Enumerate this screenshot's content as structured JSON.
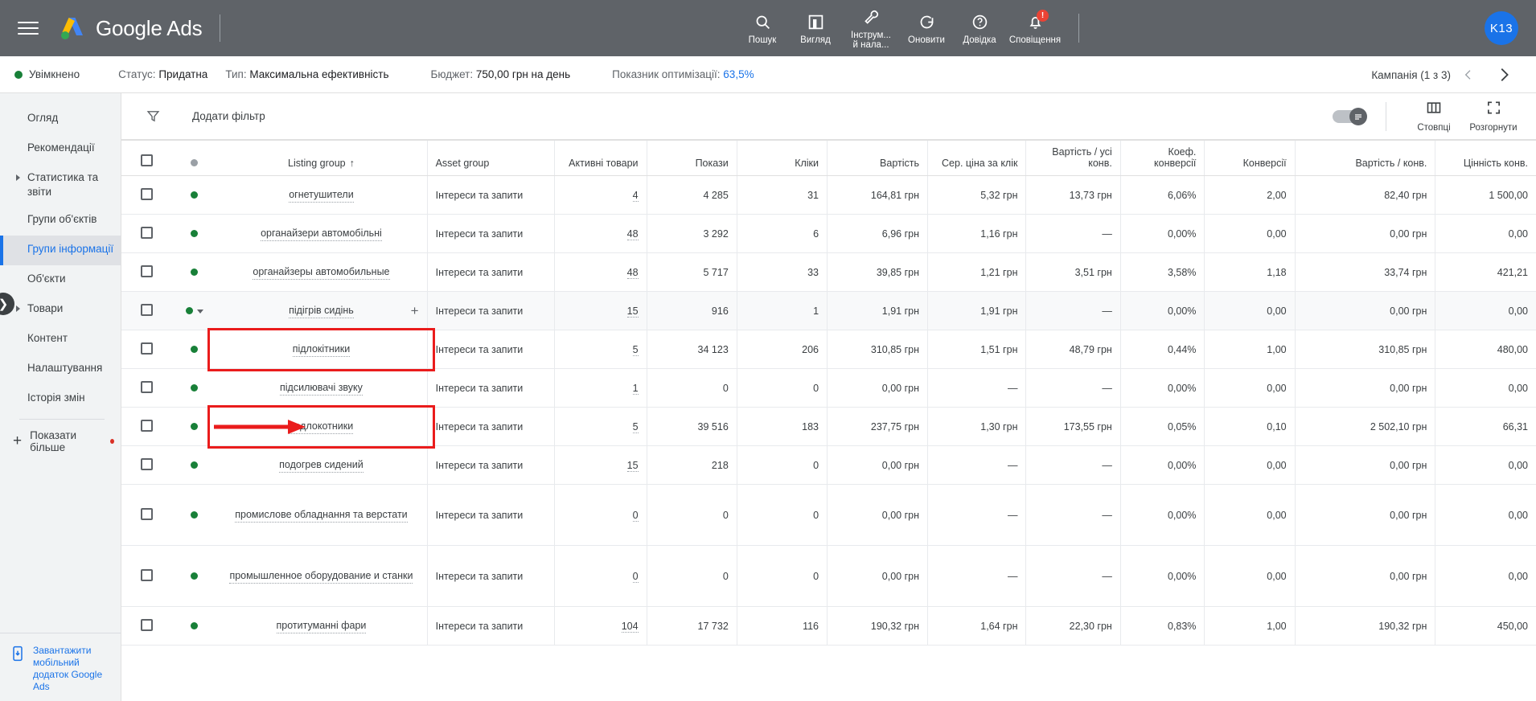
{
  "topbar": {
    "product_name": "Google Ads",
    "menu_icon": "hamburger-icon",
    "actions": [
      {
        "label": "Пошук",
        "icon": "search-icon"
      },
      {
        "label": "Вигляд",
        "icon": "view-bar-chart-icon"
      },
      {
        "label": "Інструм...",
        "label2": "й нала...",
        "icon": "wrench-tools-icon"
      },
      {
        "label": "Оновити",
        "icon": "refresh-icon"
      },
      {
        "label": "Довідка",
        "icon": "help-question-icon"
      },
      {
        "label": "Сповіщення",
        "icon": "bell-notifications-icon",
        "badge": "!"
      }
    ],
    "avatar": "K13",
    "accent_blue": "#1a73e8",
    "bar_bg": "#5f6368"
  },
  "statusbar": {
    "enabled_label": "Увімкнено",
    "status_prefix": "Статус:",
    "status_value": "Придатна",
    "type_prefix": "Тип:",
    "type_value": "Максимальна ефективність",
    "budget_prefix": "Бюджет:",
    "budget_value": "750,00 грн на день",
    "optscore_prefix": "Показник оптимізації:",
    "optscore_value": "63,5%",
    "campaign_nav": "Кампанія (1 з 3)",
    "green": "#188038"
  },
  "sidebar": {
    "items": [
      {
        "label": "Огляд",
        "expandable": false,
        "active": false
      },
      {
        "label": "Рекомендації",
        "expandable": false,
        "active": false
      },
      {
        "label": "Статистика та звіти",
        "expandable": true,
        "active": false
      },
      {
        "label": "Групи об'єктів",
        "expandable": false,
        "active": false
      },
      {
        "label": "Групи інформації",
        "expandable": false,
        "active": true
      },
      {
        "label": "Об'єкти",
        "expandable": false,
        "active": false
      },
      {
        "label": "Товари",
        "expandable": true,
        "active": false
      },
      {
        "label": "Контент",
        "expandable": false,
        "active": false
      },
      {
        "label": "Налаштування",
        "expandable": false,
        "active": false
      },
      {
        "label": "Історія змін",
        "expandable": false,
        "active": false
      }
    ],
    "show_more": "Показати більше",
    "footer_link": "Завантажити мобільний додаток Google Ads",
    "footer_icon": "mobile-download-icon"
  },
  "toolbar": {
    "filter_icon": "funnel-filter-icon",
    "add_filter": "Додати фільтр",
    "toggle_icon": "table-chart-toggle",
    "columns_label": "Стовпці",
    "columns_icon": "columns-icon",
    "expand_label": "Розгорнути",
    "expand_icon": "fullscreen-expand-icon"
  },
  "table": {
    "columns": [
      "Listing group",
      "Asset group",
      "Активні товари",
      "Покази",
      "Кліки",
      "Вартість",
      "Сер. ціна за клік",
      "Вартість / усі конв.",
      "Коеф. конверсії",
      "Конверсії",
      "Вартість / конв.",
      "Цінність конв."
    ],
    "sort_column": "Listing group",
    "sort_dir": "↑",
    "rows": [
      {
        "name": "огнетушители",
        "asset_group": "Інтереси та запити",
        "active": "4",
        "impressions": "4 285",
        "clicks": "31",
        "cost": "164,81 грн",
        "avg_cpc": "5,32 грн",
        "cost_all_conv": "13,73 грн",
        "conv_rate": "6,06%",
        "conversions": "2,00",
        "cost_conv": "82,40 грн",
        "conv_value": "1 500,00",
        "partial": true,
        "expandable": false,
        "shaded": false,
        "highlight": false,
        "arrow": false
      },
      {
        "name": "органайзери автомобільні",
        "asset_group": "Інтереси та запити",
        "active": "48",
        "impressions": "3 292",
        "clicks": "6",
        "cost": "6,96 грн",
        "avg_cpc": "1,16 грн",
        "cost_all_conv": "—",
        "conv_rate": "0,00%",
        "conversions": "0,00",
        "cost_conv": "0,00 грн",
        "conv_value": "0,00",
        "partial": false,
        "expandable": false,
        "shaded": false,
        "highlight": false,
        "arrow": false
      },
      {
        "name": "органайзеры автомобильные",
        "asset_group": "Інтереси та запити",
        "active": "48",
        "impressions": "5 717",
        "clicks": "33",
        "cost": "39,85 грн",
        "avg_cpc": "1,21 грн",
        "cost_all_conv": "3,51 грн",
        "conv_rate": "3,58%",
        "conversions": "1,18",
        "cost_conv": "33,74 грн",
        "conv_value": "421,21",
        "partial": false,
        "expandable": false,
        "shaded": false,
        "highlight": false,
        "arrow": false
      },
      {
        "name": "підігрів сидінь",
        "asset_group": "Інтереси та запити",
        "active": "15",
        "impressions": "916",
        "clicks": "1",
        "cost": "1,91 грн",
        "avg_cpc": "1,91 грн",
        "cost_all_conv": "—",
        "conv_rate": "0,00%",
        "conversions": "0,00",
        "cost_conv": "0,00 грн",
        "conv_value": "0,00",
        "partial": false,
        "expandable": true,
        "shaded": true,
        "highlight": false,
        "arrow": false,
        "has_plus": true
      },
      {
        "name": "підлокітники",
        "asset_group": "Інтереси та запити",
        "active": "5",
        "impressions": "34 123",
        "clicks": "206",
        "cost": "310,85 грн",
        "avg_cpc": "1,51 грн",
        "cost_all_conv": "48,79 грн",
        "conv_rate": "0,44%",
        "conversions": "1,00",
        "cost_conv": "310,85 грн",
        "conv_value": "480,00",
        "partial": false,
        "expandable": false,
        "shaded": false,
        "highlight": true,
        "arrow": false
      },
      {
        "name": "підсилювачі звуку",
        "asset_group": "Інтереси та запити",
        "active": "1",
        "impressions": "0",
        "clicks": "0",
        "cost": "0,00 грн",
        "avg_cpc": "—",
        "cost_all_conv": "—",
        "conv_rate": "0,00%",
        "conversions": "0,00",
        "cost_conv": "0,00 грн",
        "conv_value": "0,00",
        "partial": false,
        "expandable": false,
        "shaded": false,
        "highlight": false,
        "arrow": false
      },
      {
        "name": "подлокотники",
        "asset_group": "Інтереси та запити",
        "active": "5",
        "impressions": "39 516",
        "clicks": "183",
        "cost": "237,75 грн",
        "avg_cpc": "1,30 грн",
        "cost_all_conv": "173,55 грн",
        "conv_rate": "0,05%",
        "conversions": "0,10",
        "cost_conv": "2 502,10 грн",
        "conv_value": "66,31",
        "partial": false,
        "expandable": false,
        "shaded": false,
        "highlight": true,
        "arrow": true
      },
      {
        "name": "подогрев сидений",
        "asset_group": "Інтереси та запити",
        "active": "15",
        "impressions": "218",
        "clicks": "0",
        "cost": "0,00 грн",
        "avg_cpc": "—",
        "cost_all_conv": "—",
        "conv_rate": "0,00%",
        "conversions": "0,00",
        "cost_conv": "0,00 грн",
        "conv_value": "0,00",
        "partial": false,
        "expandable": false,
        "shaded": false,
        "highlight": false,
        "arrow": false
      },
      {
        "name": "промислове обладнання та верстати",
        "asset_group": "Інтереси та запити",
        "active": "0",
        "impressions": "0",
        "clicks": "0",
        "cost": "0,00 грн",
        "avg_cpc": "—",
        "cost_all_conv": "—",
        "conv_rate": "0,00%",
        "conversions": "0,00",
        "cost_conv": "0,00 грн",
        "conv_value": "0,00",
        "partial": false,
        "expandable": false,
        "shaded": false,
        "highlight": false,
        "arrow": false,
        "tall": true
      },
      {
        "name": "промышленное оборудование и станки",
        "asset_group": "Інтереси та запити",
        "active": "0",
        "impressions": "0",
        "clicks": "0",
        "cost": "0,00 грн",
        "avg_cpc": "—",
        "cost_all_conv": "—",
        "conv_rate": "0,00%",
        "conversions": "0,00",
        "cost_conv": "0,00 грн",
        "conv_value": "0,00",
        "partial": false,
        "expandable": false,
        "shaded": false,
        "highlight": false,
        "arrow": false,
        "tall": true
      },
      {
        "name": "протитуманні фари",
        "asset_group": "Інтереси та запити",
        "active": "104",
        "impressions": "17 732",
        "clicks": "116",
        "cost": "190,32 грн",
        "avg_cpc": "1,64 грн",
        "cost_all_conv": "22,30 грн",
        "conv_rate": "0,83%",
        "conversions": "1,00",
        "cost_conv": "190,32 грн",
        "conv_value": "450,00",
        "partial": false,
        "expandable": false,
        "shaded": false,
        "highlight": false,
        "arrow": false
      }
    ]
  },
  "annotation": {
    "box_color": "#ea1c1c",
    "arrow_color": "#ea1c1c"
  }
}
